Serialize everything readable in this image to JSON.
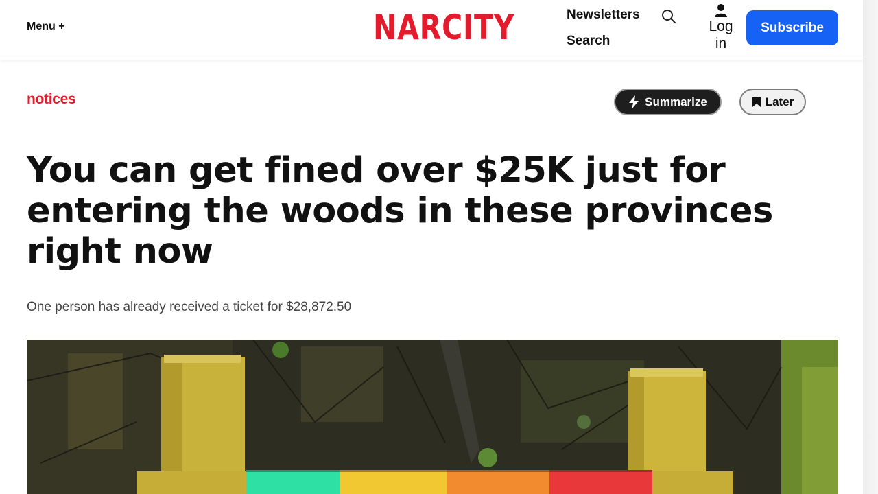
{
  "header": {
    "menu_label": "Menu +",
    "logo_text": "NARCITY",
    "nav": {
      "newsletters": "Newsletters",
      "search": "Search",
      "login_line1": "Log",
      "login_line2": "in"
    },
    "subscribe_label": "Subscribe",
    "icons": [
      "search-icon",
      "user-icon"
    ]
  },
  "article": {
    "category": "notices",
    "actions": {
      "summarize_label": "Summarize",
      "later_label": "Later",
      "icons": [
        "lightning-icon",
        "bookmark-icon"
      ]
    },
    "headline": "You can get fined over $25K just for entering the woods in these provinces right now",
    "subheadline": "One person has already received a ticket for $28,872.50"
  },
  "colors": {
    "brand_red": "#e41b2c",
    "subscribe_blue": "#1662f5",
    "summarize_dark": "#1e1e1e"
  }
}
